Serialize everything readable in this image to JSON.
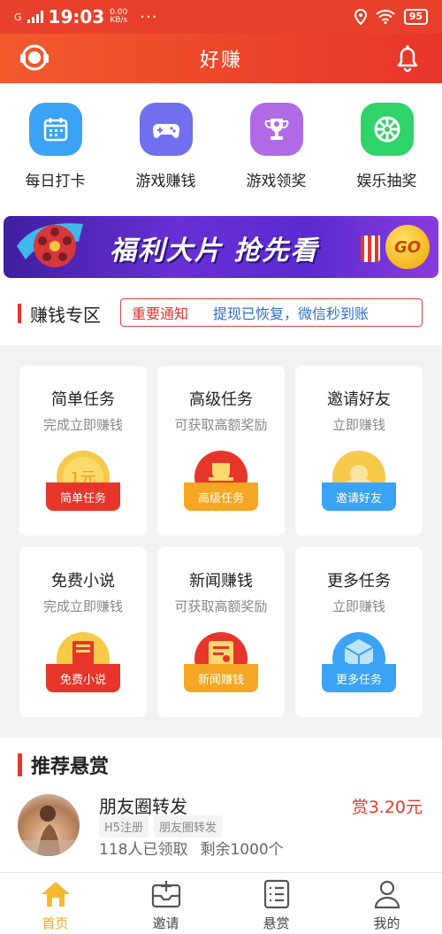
{
  "status_bar": {
    "carrier": "G",
    "time": "19:03",
    "speed_value": "0.00",
    "speed_unit": "KB/s",
    "more": "···",
    "battery": "95"
  },
  "header": {
    "title": "好赚"
  },
  "quick_menu": [
    {
      "label": "每日打卡",
      "icon": "calendar-icon",
      "color": "#3aa3f5"
    },
    {
      "label": "游戏赚钱",
      "icon": "gamepad-icon",
      "color": "#6f6ff0"
    },
    {
      "label": "游戏领奖",
      "icon": "trophy-icon",
      "color": "#b16ae6"
    },
    {
      "label": "娱乐抽奖",
      "icon": "wheel-icon",
      "color": "#2fd36a"
    }
  ],
  "banner": {
    "text": "福利大片 抢先看",
    "button": "GO"
  },
  "earn_zone": {
    "title": "赚钱专区",
    "notice_tag": "重要通知",
    "notice_msg": "提现已恢复，微信秒到账"
  },
  "tasks": [
    {
      "title": "简单任务",
      "subtitle": "完成立即赚钱",
      "badge_label": "简单任务",
      "badge_center": "1元",
      "ribbon": "#e8352a"
    },
    {
      "title": "高级任务",
      "subtitle": "可获取高额奖励",
      "badge_label": "高级任务",
      "badge_center": "",
      "ribbon": "#f5a623"
    },
    {
      "title": "邀请好友",
      "subtitle": "立即赚钱",
      "badge_label": "邀请好友",
      "badge_center": "",
      "ribbon": "#3aa3f5"
    },
    {
      "title": "免费小说",
      "subtitle": "完成立即赚钱",
      "badge_label": "免费小说",
      "badge_center": "",
      "ribbon": "#e8352a"
    },
    {
      "title": "新闻赚钱",
      "subtitle": "可获取高额奖励",
      "badge_label": "新闻赚钱",
      "badge_center": "",
      "ribbon": "#f5a623"
    },
    {
      "title": "更多任务",
      "subtitle": "立即赚钱",
      "badge_label": "更多任务",
      "badge_center": "",
      "ribbon": "#3aa3f5"
    }
  ],
  "rewards": {
    "title": "推荐悬赏",
    "items": [
      {
        "name": "朋友圈转发",
        "amount": "赏3.20元",
        "tags": [
          "H5注册",
          "朋友圈转发"
        ],
        "claimed": "118人已领取",
        "remaining": "剩余1000个"
      }
    ]
  },
  "tab_bar": [
    {
      "label": "首页",
      "icon": "home-icon",
      "active": true
    },
    {
      "label": "邀请",
      "icon": "invite-icon",
      "active": false
    },
    {
      "label": "悬赏",
      "icon": "list-icon",
      "active": false
    },
    {
      "label": "我的",
      "icon": "user-icon",
      "active": false
    }
  ]
}
